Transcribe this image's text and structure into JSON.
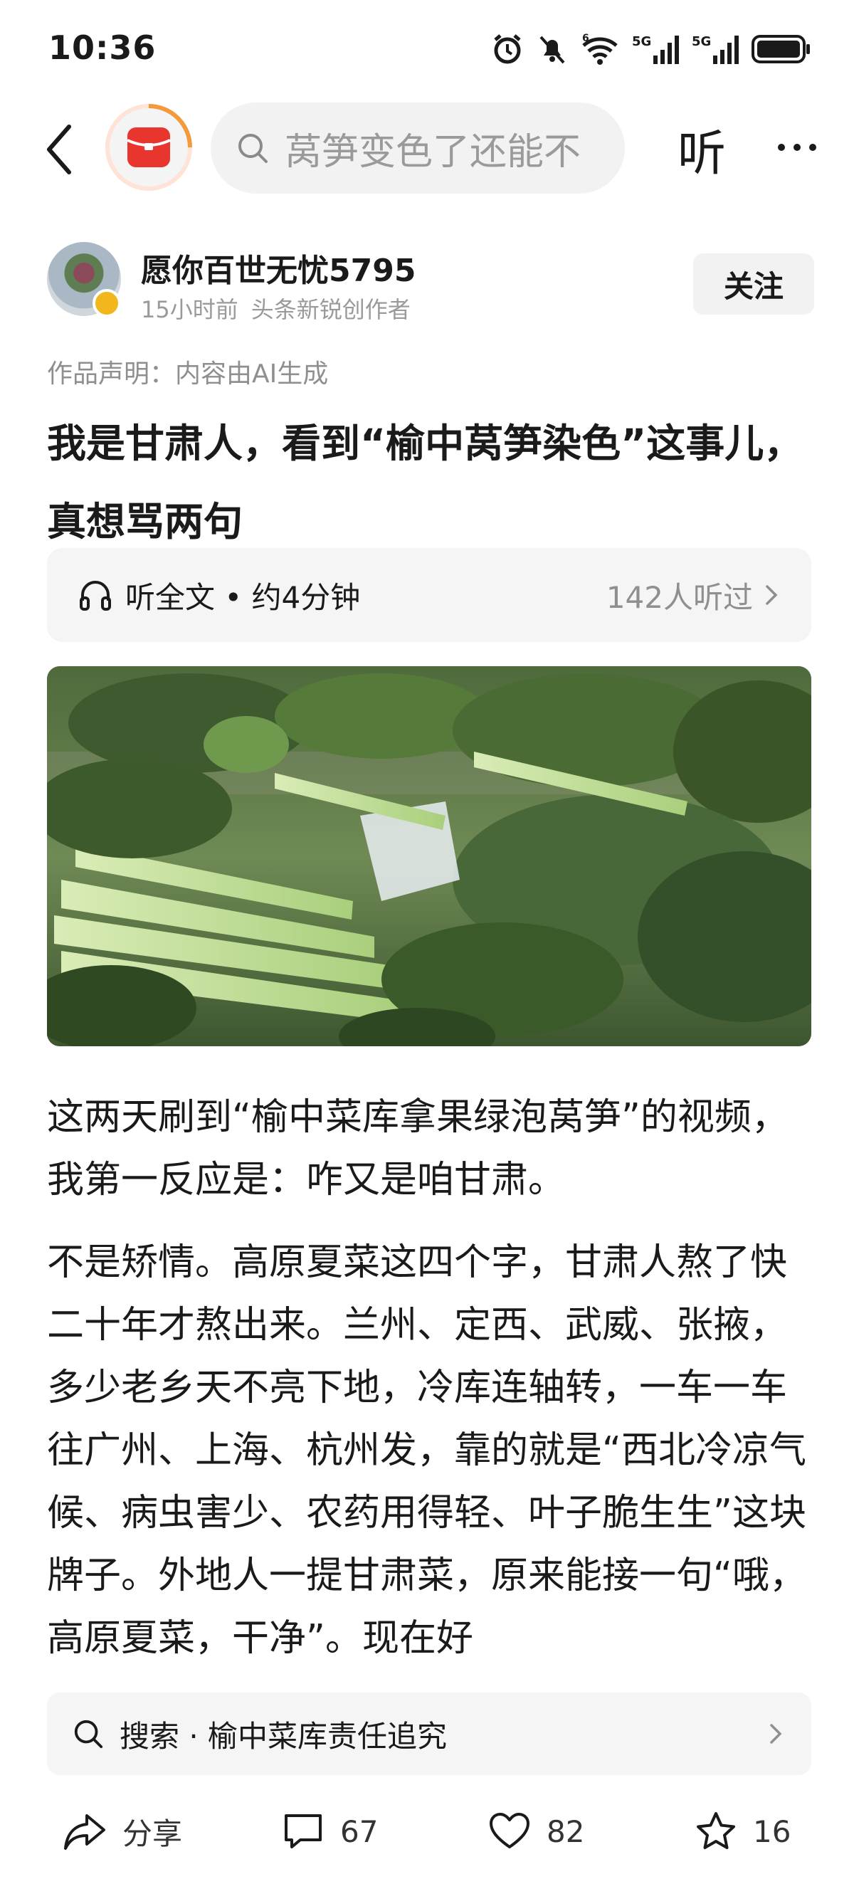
{
  "status_bar": {
    "time": "10:36",
    "network_1": "5G",
    "network_2": "5G",
    "wifi_label": "6"
  },
  "nav": {
    "search_query": "莴笋变色了还能不",
    "listen_label": "听"
  },
  "author": {
    "name": "愿你百世无忧5795",
    "posted": "15小时前",
    "badge": "头条新锐创作者",
    "follow_label": "关注"
  },
  "declaration": "作品声明：内容由AI生成",
  "article": {
    "title": "我是甘肃人，看到“榆中莴笋染色”这事儿，真想骂两句",
    "paragraphs": [
      "这两天刷到“榆中菜库拿果绿泡莴笋”的视频，我第一反应是：咋又是咱甘肃。",
      "不是矫情。高原夏菜这四个字，甘肃人熬了快二十年才熬出来。兰州、定西、武威、张掖，多少老乡天不亮下地，冷库连轴转，一车一车往广州、上海、杭州发，靠的就是“西北冷凉气候、病虫害少、农药用得轻、叶子脆生生”这块牌子。外地人一提甘肃菜，原来能接一句“哦，高原夏菜，干净”。现在好"
    ]
  },
  "listen_bar": {
    "label": "听全文 • 约4分钟",
    "count": "142人听过"
  },
  "search_suggestion": "搜索 · 榆中菜库责任追究",
  "actions": {
    "share": "分享",
    "comments": "67",
    "likes": "82",
    "favorites": "16"
  },
  "colors": {
    "accent_red": "#e8352e",
    "logo_ring": "#f39a3c",
    "muted": "#8f8f8f",
    "panel": "#f5f5f5"
  },
  "icons": [
    "back-icon",
    "app-logo-icon",
    "search-icon",
    "more-icon",
    "headphones-icon",
    "chevron-right-icon",
    "share-icon",
    "comment-icon",
    "heart-icon",
    "star-icon"
  ]
}
